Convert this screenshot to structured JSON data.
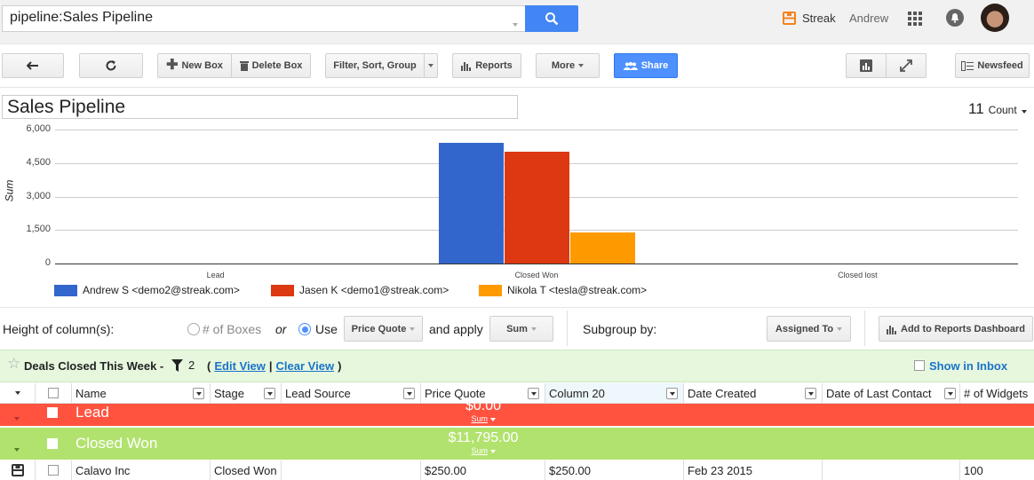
{
  "search": {
    "query": "pipeline:Sales Pipeline"
  },
  "header": {
    "brand": "Streak",
    "user": "Andrew"
  },
  "toolbar": {
    "new_box": "New Box",
    "delete_box": "Delete Box",
    "filter": "Filter, Sort, Group",
    "reports": "Reports",
    "more": "More",
    "share": "Share",
    "newsfeed": "Newsfeed"
  },
  "report": {
    "title": "Sales Pipeline",
    "count_value": "11",
    "count_label": "Count"
  },
  "chart_data": {
    "type": "bar",
    "categories": [
      "Lead",
      "Closed Won",
      "Closed lost"
    ],
    "series": [
      {
        "name": "Andrew S <demo2@streak.com>",
        "color": "#3366cc",
        "values": [
          0,
          5400,
          0
        ]
      },
      {
        "name": "Jasen K <demo1@streak.com>",
        "color": "#dc3912",
        "values": [
          0,
          5000,
          0
        ]
      },
      {
        "name": "Nikola T <tesla@streak.com>",
        "color": "#ff9900",
        "values": [
          0,
          1395,
          0
        ]
      }
    ],
    "ylabel": "Sum",
    "ylim": [
      0,
      6000
    ],
    "yticks": [
      "6,000",
      "4,500",
      "3,000",
      "1,500",
      "0"
    ],
    "grid": true,
    "legend": "bottom"
  },
  "controls": {
    "height_label": "Height of column(s):",
    "boxes_option": "# of Boxes",
    "or": "or",
    "use": "Use",
    "price_quote": "Price Quote",
    "and_apply": "and apply",
    "sum": "Sum",
    "subgroup_label": "Subgroup by:",
    "assigned_to": "Assigned To",
    "add_dashboard": "Add to Reports Dashboard"
  },
  "filterbar": {
    "name": "Deals Closed This Week -",
    "filter_count": "2",
    "open_paren": "(",
    "edit": "Edit View",
    "sep": "|",
    "clear": "Clear View",
    "close_paren": ")",
    "show_inbox": "Show in Inbox"
  },
  "table": {
    "headers": [
      "Name",
      "Stage",
      "Lead Source",
      "Price Quote",
      "Column 20",
      "Date Created",
      "Date of Last Contact",
      "# of Widgets"
    ],
    "groups": [
      {
        "name": "Lead",
        "total": "$0.00",
        "agg": "Sum",
        "color": "#ff5340"
      },
      {
        "name": "Closed Won",
        "total": "$11,795.00",
        "agg": "Sum",
        "color": "#b2e26e"
      }
    ],
    "rows": [
      {
        "name": "Calavo Inc",
        "stage": "Closed Won",
        "lead_source": "",
        "price_quote": "$250.00",
        "column20": "$250.00",
        "date_created": "Feb 23 2015",
        "last_contact": "",
        "widgets": "100"
      }
    ]
  }
}
